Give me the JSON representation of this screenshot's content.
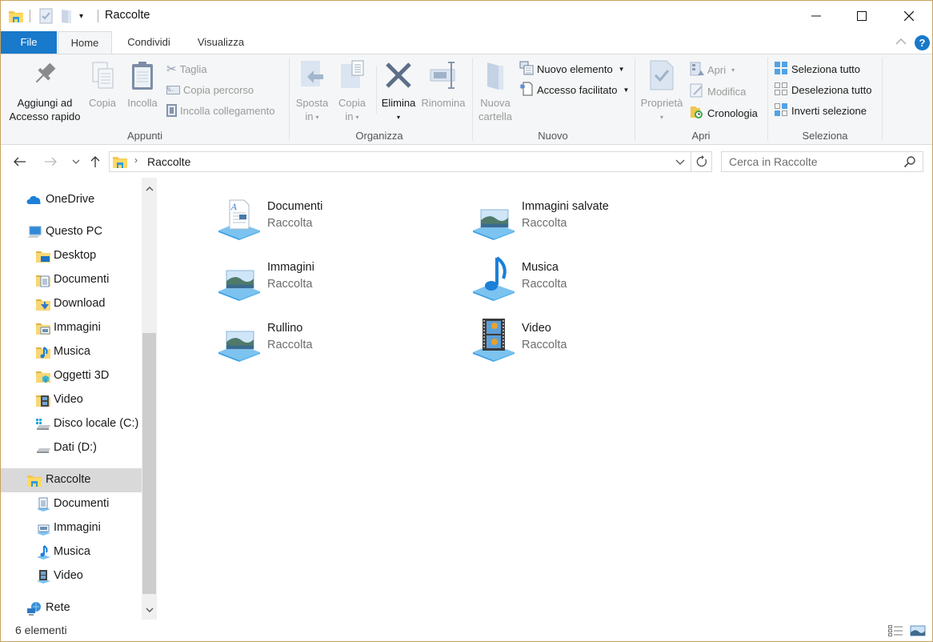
{
  "window": {
    "title": "Raccolte",
    "controls": {
      "minimize": "minimize-icon",
      "maximize": "maximize-icon",
      "close": "close-icon"
    }
  },
  "quick_access": {
    "icons": [
      "library-folder-icon",
      "properties-check-icon",
      "new-folder-icon",
      "customize-dropdown-icon"
    ]
  },
  "ribbon_tabs": [
    {
      "label": "File",
      "active": false
    },
    {
      "label": "Home",
      "active": true
    },
    {
      "label": "Condividi",
      "active": false
    },
    {
      "label": "Visualizza",
      "active": false
    }
  ],
  "ribbon": {
    "appunti": {
      "label": "Appunti",
      "pin": {
        "line1": "Aggiungi ad",
        "line2": "Accesso rapido",
        "enabled": true
      },
      "copy": {
        "label": "Copia",
        "enabled": false
      },
      "paste": {
        "label": "Incolla",
        "enabled": false
      },
      "cut": {
        "label": "Taglia",
        "enabled": false
      },
      "copy_path": {
        "label": "Copia percorso",
        "enabled": false
      },
      "paste_shortcut": {
        "label": "Incolla collegamento",
        "enabled": false
      }
    },
    "organizza": {
      "label": "Organizza",
      "move_to": {
        "line1": "Sposta",
        "line2": "in",
        "enabled": false
      },
      "copy_to": {
        "line1": "Copia",
        "line2": "in",
        "enabled": false
      },
      "delete": {
        "label": "Elimina",
        "enabled": true
      },
      "rename": {
        "label": "Rinomina",
        "enabled": false
      }
    },
    "nuovo": {
      "label": "Nuovo",
      "new_folder": {
        "line1": "Nuova",
        "line2": "cartella",
        "enabled": false
      },
      "new_item": {
        "label": "Nuovo elemento",
        "enabled": true
      },
      "easy_access": {
        "label": "Accesso facilitato",
        "enabled": true
      }
    },
    "apri": {
      "label": "Apri",
      "properties": {
        "label": "Proprietà",
        "enabled": false
      },
      "open": {
        "label": "Apri",
        "enabled": false
      },
      "edit": {
        "label": "Modifica",
        "enabled": false
      },
      "history": {
        "label": "Cronologia",
        "enabled": true
      }
    },
    "seleziona": {
      "label": "Seleziona",
      "select_all": {
        "label": "Seleziona tutto"
      },
      "select_none": {
        "label": "Deseleziona tutto"
      },
      "invert": {
        "label": "Inverti selezione"
      }
    }
  },
  "navbar": {
    "back": "back-arrow-icon",
    "forward": "forward-arrow-icon",
    "recent": "recent-locations-icon",
    "up": "up-arrow-icon",
    "breadcrumb": [
      "Raccolte"
    ],
    "search_placeholder": "Cerca in Raccolte",
    "search_value": ""
  },
  "sidebar": {
    "items": [
      {
        "label": "OneDrive",
        "icon": "onedrive-icon",
        "level": 0
      },
      {
        "label": "Questo PC",
        "icon": "computer-icon",
        "level": 0
      },
      {
        "label": "Desktop",
        "icon": "desktop-folder-icon",
        "level": 1
      },
      {
        "label": "Documenti",
        "icon": "documents-folder-icon",
        "level": 1
      },
      {
        "label": "Download",
        "icon": "downloads-folder-icon",
        "level": 1
      },
      {
        "label": "Immagini",
        "icon": "pictures-folder-icon",
        "level": 1
      },
      {
        "label": "Musica",
        "icon": "music-folder-icon",
        "level": 1
      },
      {
        "label": "Oggetti 3D",
        "icon": "3d-objects-folder-icon",
        "level": 1
      },
      {
        "label": "Video",
        "icon": "videos-folder-icon",
        "level": 1
      },
      {
        "label": "Disco locale (C:)",
        "icon": "system-drive-icon",
        "level": 1
      },
      {
        "label": "Dati (D:)",
        "icon": "drive-icon",
        "level": 1
      },
      {
        "label": "Raccolte",
        "icon": "libraries-icon",
        "level": 0,
        "selected": true
      },
      {
        "label": "Documenti",
        "icon": "documents-library-icon",
        "level": 1
      },
      {
        "label": "Immagini",
        "icon": "pictures-library-icon",
        "level": 1
      },
      {
        "label": "Musica",
        "icon": "music-library-icon",
        "level": 1
      },
      {
        "label": "Video",
        "icon": "videos-library-icon",
        "level": 1
      },
      {
        "label": "Rete",
        "icon": "network-icon",
        "level": 0
      }
    ]
  },
  "libraries": [
    {
      "name": "Documenti",
      "type": "Raccolta",
      "icon": "documents-library-icon"
    },
    {
      "name": "Immagini salvate",
      "type": "Raccolta",
      "icon": "saved-pictures-library-icon"
    },
    {
      "name": "Immagini",
      "type": "Raccolta",
      "icon": "pictures-library-icon"
    },
    {
      "name": "Musica",
      "type": "Raccolta",
      "icon": "music-library-icon"
    },
    {
      "name": "Rullino",
      "type": "Raccolta",
      "icon": "camera-roll-library-icon"
    },
    {
      "name": "Video",
      "type": "Raccolta",
      "icon": "videos-library-icon"
    }
  ],
  "status": {
    "item_count": "6 elementi",
    "views": [
      "details-view-icon",
      "tiles-view-icon"
    ]
  },
  "colors": {
    "accent": "#1979ca",
    "selected_nav": "#d9d9d9",
    "window_border": "#c9a25f",
    "ribbon_bg": "#f5f6f7"
  }
}
